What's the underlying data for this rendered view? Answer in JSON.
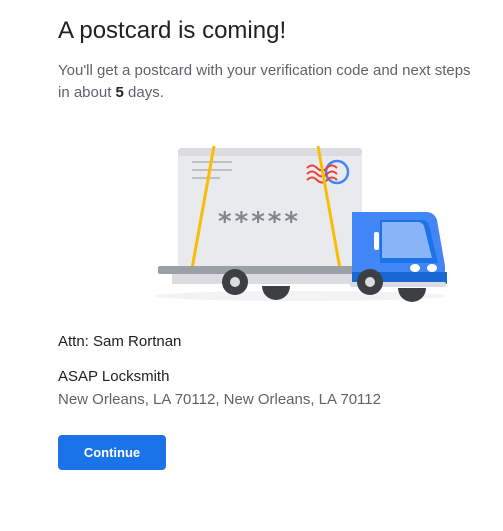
{
  "title": "A postcard is coming!",
  "description": {
    "before": "You'll get a postcard with your verification code and next steps in about ",
    "days": "5",
    "after": " days."
  },
  "illustration": {
    "code_mask": "*****",
    "colors": {
      "truck_blue": "#4285f4",
      "tape": "#fbbc04",
      "stamp_red": "#ea4335"
    }
  },
  "address": {
    "attn": "Attn: Sam Rortnan",
    "business": "ASAP Locksmith",
    "location": "New Orleans, LA 70112, New Orleans, LA 70112"
  },
  "buttons": {
    "continue": "Continue"
  }
}
